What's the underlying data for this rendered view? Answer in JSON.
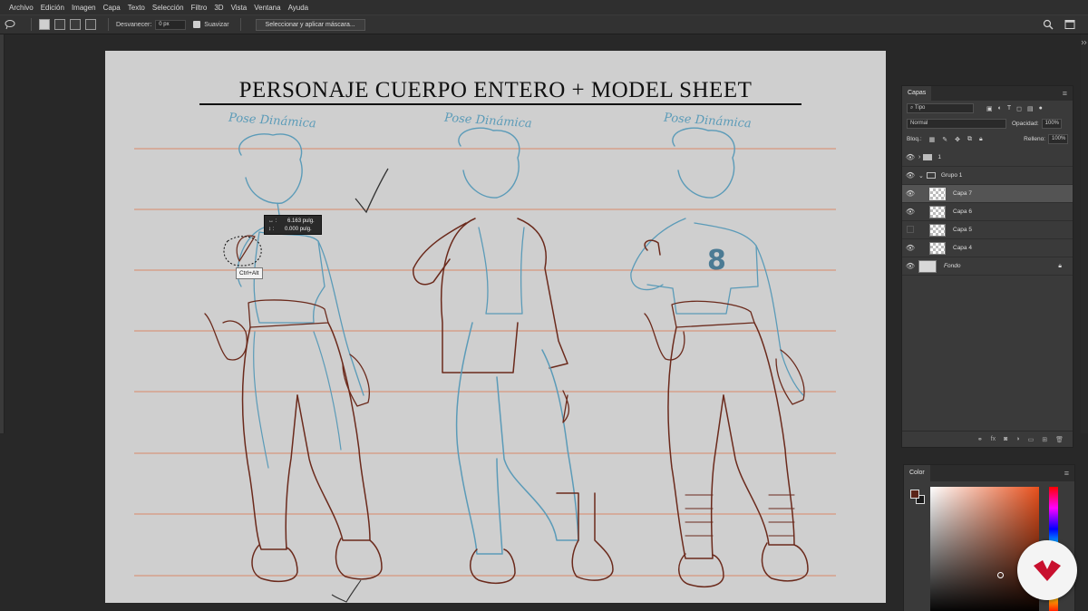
{
  "menu": {
    "items": [
      "Archivo",
      "Edición",
      "Imagen",
      "Capa",
      "Texto",
      "Selección",
      "Filtro",
      "3D",
      "Vista",
      "Ventana",
      "Ayuda"
    ]
  },
  "options": {
    "feather_label": "Desvanecer:",
    "feather_value": "0 px",
    "smooth_label": "Suavizar",
    "select_mask_button": "Seleccionar y aplicar máscara..."
  },
  "canvas": {
    "title": "PERSONAJE CUERPO ENTERO + MODEL SHEET",
    "pose_labels": [
      "Pose Dinámica",
      "Pose Dinámica",
      "Pose Dinámica"
    ],
    "shirt_number": "8"
  },
  "measure_tooltip": {
    "w_label": "↔ :",
    "w_value": "6.163 pulg.",
    "h_label": "↕ :",
    "h_value": "0.000 pulg."
  },
  "key_tooltip": "Ctrl+Alt",
  "layers_panel": {
    "tab": "Capas",
    "filter_kind": "Tipo",
    "blend_mode": "Normal",
    "opacity_label": "Opacidad:",
    "opacity_value": "100%",
    "lock_label": "Bloq.:",
    "fill_label": "Relleno:",
    "fill_value": "100%",
    "layers": [
      {
        "name": "1",
        "type": "group",
        "visible": true
      },
      {
        "name": "Grupo 1",
        "type": "group",
        "visible": true
      },
      {
        "name": "Capa 7",
        "type": "layer",
        "visible": true,
        "selected": true
      },
      {
        "name": "Capa 6",
        "type": "layer",
        "visible": true
      },
      {
        "name": "Capa 5",
        "type": "layer",
        "visible": false
      },
      {
        "name": "Capa 4",
        "type": "layer",
        "visible": true
      },
      {
        "name": "Fondo",
        "type": "background",
        "visible": true
      }
    ]
  },
  "color_panel": {
    "tab": "Color",
    "foreground": "#5a2418",
    "background": "#1a1a1a"
  },
  "colors": {
    "guide_line": "#d98a6a",
    "sketch_blue": "#5b9bb8",
    "sketch_brown": "#6b2a1c",
    "brand": "#c8102e"
  }
}
